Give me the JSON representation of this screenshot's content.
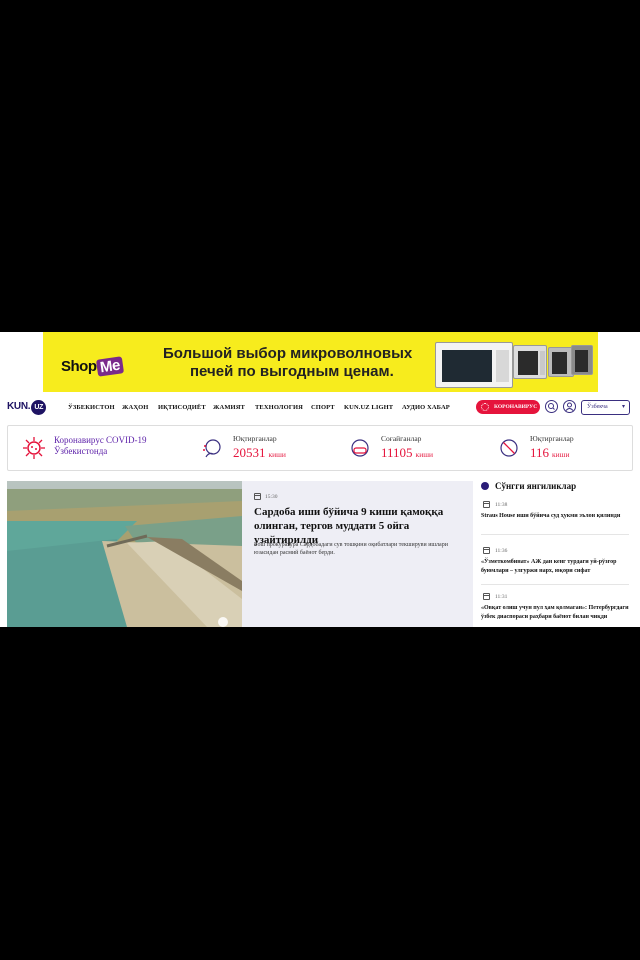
{
  "banner": {
    "brand": "ShopMe",
    "brand_shop": "Shop",
    "brand_me": "Me",
    "line1": "Большой выбор микроволновых",
    "line2": "печей по выгодным ценам."
  },
  "nav": {
    "logo_kun": "KUN.",
    "logo_uz": "UZ",
    "items": [
      "ЎЗБЕКИСТОН",
      "ЖАҲОН",
      "ИҚТИСОДИЁТ",
      "ЖАМИЯТ",
      "ТЕХНОЛОГИЯ",
      "СПОРТ",
      "KUN.UZ LIGHT",
      "АУДИО ХАБАР"
    ],
    "covid_button": "КОРОНАВИРУС",
    "language": "Ўзбекча"
  },
  "covid": {
    "title_line1": "Коронавирус COVID-19",
    "title_line2": "Ўзбекистонда",
    "stats": [
      {
        "label": "Юқтирганлар",
        "value": "20531",
        "unit": "киши",
        "icon": "cough-icon"
      },
      {
        "label": "Соғайганлар",
        "value": "11105",
        "unit": "киши",
        "icon": "mask-icon"
      },
      {
        "label": "Юқтирганлар",
        "value": "116",
        "unit": "киши",
        "icon": "no-entry-icon"
      }
    ],
    "accent": "#e5143c"
  },
  "main_article": {
    "time": "15:30",
    "title": "Сардоба иши бўйича 9 киши қамоққа олинган, тергов муддати 5 ойга узайтирилди",
    "summary": "Бош прокуратура Сардобадаги сув тошқини оқибатлари текшируви ишлари юзасидан расмий баёнот берди."
  },
  "latest": {
    "heading": "Сўнгги янгиликлар",
    "items": [
      {
        "time": "11:38",
        "title": "Straus House иши бўйича суд ҳукми эълон қилинди"
      },
      {
        "time": "11:36",
        "title": "«Ўзметкомбинат» АЖ дан кенг турдаги уй-рўзғор буюмлари – улгуржи нарх, юқори сифат"
      },
      {
        "time": "11:31",
        "title": "«Овқат олиш учун пул ҳам қолмаган»: Петербургдаги ўзбек диаспораси раҳбари баёнот билан чиқди"
      }
    ]
  },
  "colors": {
    "brand": "#1e1363",
    "accent": "#e5143c",
    "purple": "#5b1fa8",
    "banner": "#f7ec1d"
  }
}
